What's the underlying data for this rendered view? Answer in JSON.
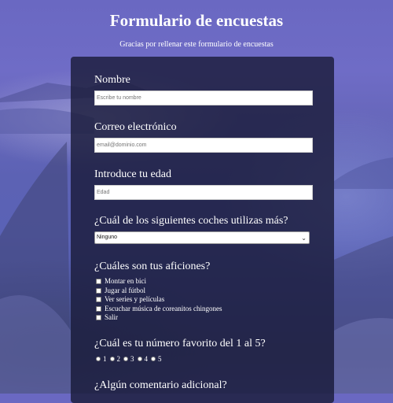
{
  "header": {
    "title": "Formulario de encuestas",
    "subtitle": "Gracias por rellenar este formulario de encuestas"
  },
  "form": {
    "name": {
      "label": "Nombre",
      "placeholder": "Escribe tu nombre"
    },
    "email": {
      "label": "Correo electrónico",
      "placeholder": "email@dominio.com"
    },
    "age": {
      "label": "Introduce tu edad",
      "placeholder": "Edad"
    },
    "car": {
      "label": "¿Cuál de los siguientes coches utilizas más?",
      "selected": "Ninguno"
    },
    "hobbies": {
      "label": "¿Cuáles son tus aficiones?",
      "options": [
        "Montar en bici",
        "Jugar al fútbol",
        "Ver series y películas",
        "Escuchar música de coreanitos chingones",
        "Salir"
      ]
    },
    "favorite": {
      "label": "¿Cuál es tu número favorito del 1 al 5?",
      "options": [
        "1",
        "2",
        "3",
        "4",
        "5"
      ]
    },
    "comment": {
      "label": "¿Algún comentario adicional?"
    }
  },
  "icons": {
    "select_arrow": "chevron-down-icon"
  }
}
